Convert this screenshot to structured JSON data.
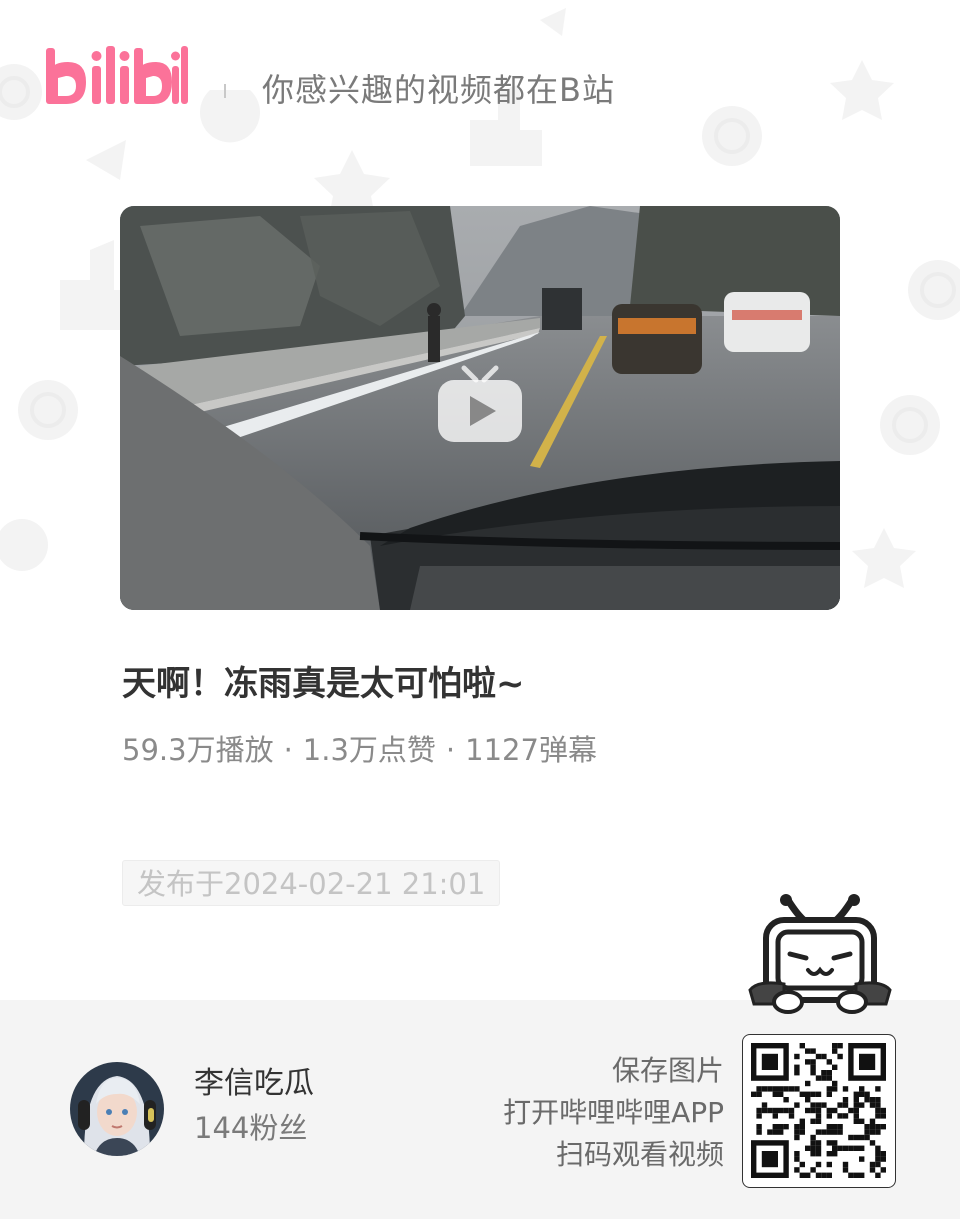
{
  "header": {
    "logo_text": "bilibili",
    "slogan": "你感兴趣的视频都在B站"
  },
  "video": {
    "title": "天啊！冻雨真是太可怕啦~",
    "stats": {
      "plays": "59.3万播放",
      "likes": "1.3万点赞",
      "danmaku": "1127弹幕",
      "separator": "·"
    },
    "publish_date": "发布于2024-02-21 21:01"
  },
  "author": {
    "name": "李信吃瓜",
    "fans": "144粉丝"
  },
  "qr": {
    "hint_lines": [
      "保存图片",
      "打开哔哩哔哩APP",
      "扫码观看视频"
    ]
  },
  "colors": {
    "brand_pink": "#fb7299",
    "footer_bg": "#f4f4f4",
    "text_dark": "#333333",
    "text_gray": "#8a8a8a"
  },
  "icons": {
    "play": "tv-play-icon",
    "mascot": "bilibili-tv-mascot-icon"
  }
}
